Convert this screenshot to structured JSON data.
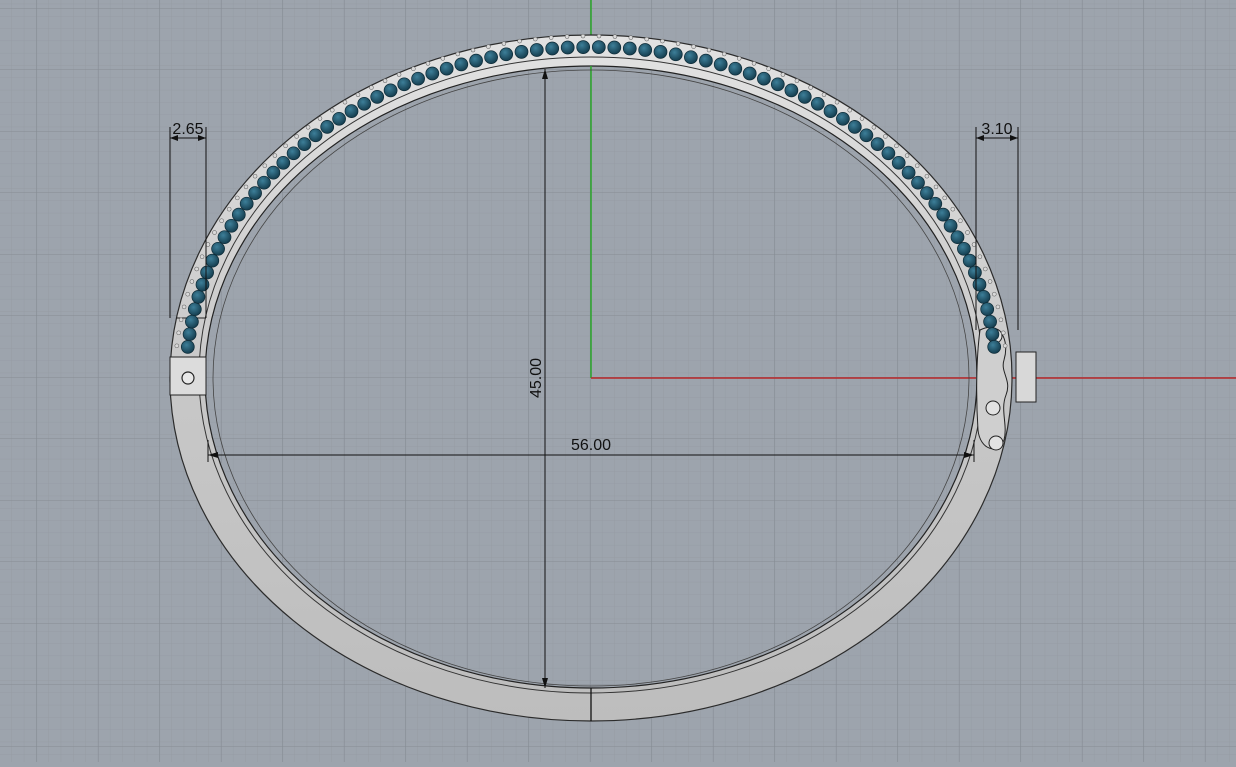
{
  "viewport": {
    "grid_color": "#8b929b",
    "background": "#9da4ad",
    "x_axis_color": "#b8262a",
    "y_axis_color": "#2aa52a"
  },
  "model": {
    "metal_color": "#cfcfcf",
    "stone_color": "#1f5a72",
    "stone_count": 78
  },
  "dimensions": {
    "width_label": "56.00",
    "height_label": "45.00",
    "left_band_label": "2.65",
    "right_band_label": "3.10"
  }
}
